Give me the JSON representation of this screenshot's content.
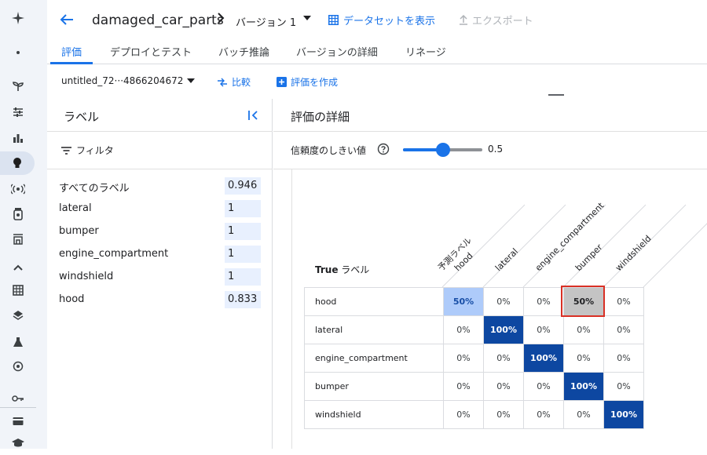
{
  "app": {
    "title": "damaged_car_parts",
    "version": "バージョン 1",
    "show_dataset": "データセットを表示",
    "export": "エクスポート"
  },
  "tabs": [
    {
      "label": "評価",
      "active": true
    },
    {
      "label": "デプロイとテスト",
      "active": false
    },
    {
      "label": "バッチ推論",
      "active": false
    },
    {
      "label": "バージョンの詳細",
      "active": false
    },
    {
      "label": "リネージ",
      "active": false
    }
  ],
  "toolbar": {
    "model": "untitled_72···4866204672",
    "compare": "比較",
    "create_eval": "評価を作成"
  },
  "labels_panel": {
    "title": "ラベル",
    "filter": "フィルタ",
    "rows": [
      {
        "name": "すべてのラベル",
        "value": "0.946"
      },
      {
        "name": "lateral",
        "value": "1"
      },
      {
        "name": "bumper",
        "value": "1"
      },
      {
        "name": "engine_compartment",
        "value": "1"
      },
      {
        "name": "windshield",
        "value": "1"
      },
      {
        "name": "hood",
        "value": "0.833"
      }
    ]
  },
  "details": {
    "title": "評価の詳細",
    "threshold_label": "信頼度のしきい値",
    "threshold_value": "0.5",
    "threshold_fraction": 0.5
  },
  "matrix": {
    "true_label": "True",
    "true_label_suffix": "ラベル",
    "predicted_label": "予測ラベル",
    "columns": [
      "hood",
      "lateral",
      "engine_compartment",
      "bumper",
      "windshield"
    ],
    "rows": [
      {
        "label": "hood",
        "cells": [
          "50%",
          "0%",
          "0%",
          "50%",
          "0%"
        ]
      },
      {
        "label": "lateral",
        "cells": [
          "0%",
          "100%",
          "0%",
          "0%",
          "0%"
        ]
      },
      {
        "label": "engine_compartment",
        "cells": [
          "0%",
          "0%",
          "100%",
          "0%",
          "0%"
        ]
      },
      {
        "label": "bumper",
        "cells": [
          "0%",
          "0%",
          "0%",
          "100%",
          "0%"
        ]
      },
      {
        "label": "windshield",
        "cells": [
          "0%",
          "0%",
          "0%",
          "0%",
          "100%"
        ]
      }
    ],
    "highlighted_cell": {
      "row": 0,
      "col": 3
    },
    "colors": {
      "full": "#0d47a1",
      "partial": "#aecbfa",
      "highlight": "#c4c4c4",
      "highlight_border": "#d93025"
    }
  }
}
